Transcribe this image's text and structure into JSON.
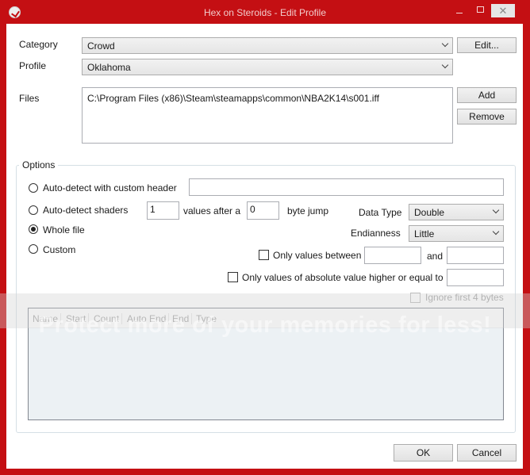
{
  "window": {
    "title": "Hex on Steroids - Edit Profile",
    "min_glyph": "",
    "max_glyph": "",
    "close_glyph": "✕"
  },
  "category": {
    "label": "Category",
    "value": "Crowd",
    "edit_button": "Edit..."
  },
  "profile": {
    "label": "Profile",
    "value": "Oklahoma"
  },
  "files": {
    "label": "Files",
    "entries": [
      "C:\\Program Files (x86)\\Steam\\steamapps\\common\\NBA2K14\\s001.iff"
    ],
    "add_button": "Add",
    "remove_button": "Remove"
  },
  "options": {
    "title": "Options",
    "radio_custom_header": "Auto-detect with custom header",
    "custom_header_value": "",
    "radio_shaders": "Auto-detect shaders",
    "shaders_count": "1",
    "values_after_label": "values after a",
    "byte_jump_value": "0",
    "byte_jump_label": "byte jump",
    "radio_whole_file": "Whole file",
    "radio_custom": "Custom",
    "selected_mode": "whole_file",
    "data_type_label": "Data Type",
    "data_type_value": "Double",
    "endianness_label": "Endianness",
    "endianness_value": "Little",
    "between_label": "Only values between",
    "between_min": "",
    "and_label": "and",
    "between_max": "",
    "abs_label": "Only values of absolute value higher or equal to",
    "abs_value": "",
    "ignore_label": "Ignore first 4 bytes"
  },
  "table": {
    "columns": [
      "Name",
      "Start",
      "Count",
      "Auto End",
      "End",
      "Type"
    ]
  },
  "watermark": "Protect more of your memories for less!",
  "footer": {
    "ok_button": "OK",
    "cancel_button": "Cancel"
  },
  "colors": {
    "frame": "#c40f13",
    "accent_border": "#abadb3"
  }
}
